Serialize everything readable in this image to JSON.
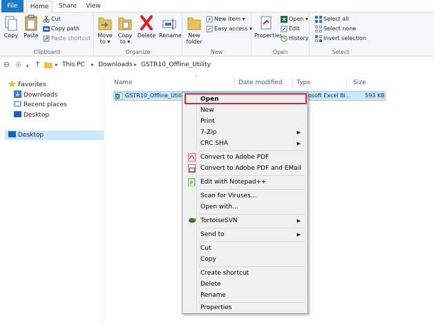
{
  "ribbon_tabs": [
    "File",
    "Home",
    "Share",
    "View"
  ],
  "ribbon": {
    "clipboard": {
      "copy": "Copy",
      "paste": "Paste",
      "cut": "Cut",
      "copy_path": "Copy path",
      "paste_shortcut": "Paste shortcut",
      "label": "Clipboard"
    },
    "organize": {
      "move_to": "Move to ▾",
      "copy_to": "Copy to ▾",
      "delete": "Delete",
      "rename": "Rename",
      "label": "Organize"
    },
    "new": {
      "new_folder": "New folder",
      "new_item": "New item ▾",
      "easy_access": "Easy access ▾",
      "label": "New"
    },
    "open": {
      "properties": "Properties",
      "open": "Open ▾",
      "edit": "Edit",
      "history": "History",
      "label": "Open"
    },
    "select": {
      "select_all": "Select all",
      "select_none": "Select none",
      "invert_selection": "Invert selection",
      "label": "Select"
    }
  },
  "address": {
    "crumbs": [
      "This PC",
      "Downloads",
      "GSTR10_Offline_Utility"
    ]
  },
  "nav_pane": {
    "favorites": "Favorites",
    "downloads": "Downloads",
    "recent_places": "Recent places",
    "desktop_fav": "Desktop",
    "desktop": "Desktop"
  },
  "columns": {
    "name": "Name",
    "date_modified": "Date modified",
    "type": "Type",
    "size": "Size"
  },
  "file": {
    "name": "GSTR10_Offline_Utility",
    "type": "osoft Excel Bi...",
    "size": "593 KB"
  },
  "context_menu": {
    "open": "Open",
    "new": "New",
    "print": "Print",
    "zip": "7-Zip",
    "crc": "CRC SHA",
    "convert_pdf": "Convert to Adobe PDF",
    "convert_pdf_email": "Convert to Adobe PDF and EMail",
    "notepad": "Edit with Notepad++",
    "scan": "Scan for Viruses...",
    "open_with": "Open with...",
    "tortoise": "TortoiseSVN",
    "send_to": "Send to",
    "cut": "Cut",
    "copy": "Copy",
    "create_shortcut": "Create shortcut",
    "delete": "Delete",
    "rename": "Rename",
    "properties": "Properties"
  },
  "colors": {
    "file_tab": "#1979ca",
    "selection": "#cce8ff",
    "highlight_border": "#d9263b"
  }
}
